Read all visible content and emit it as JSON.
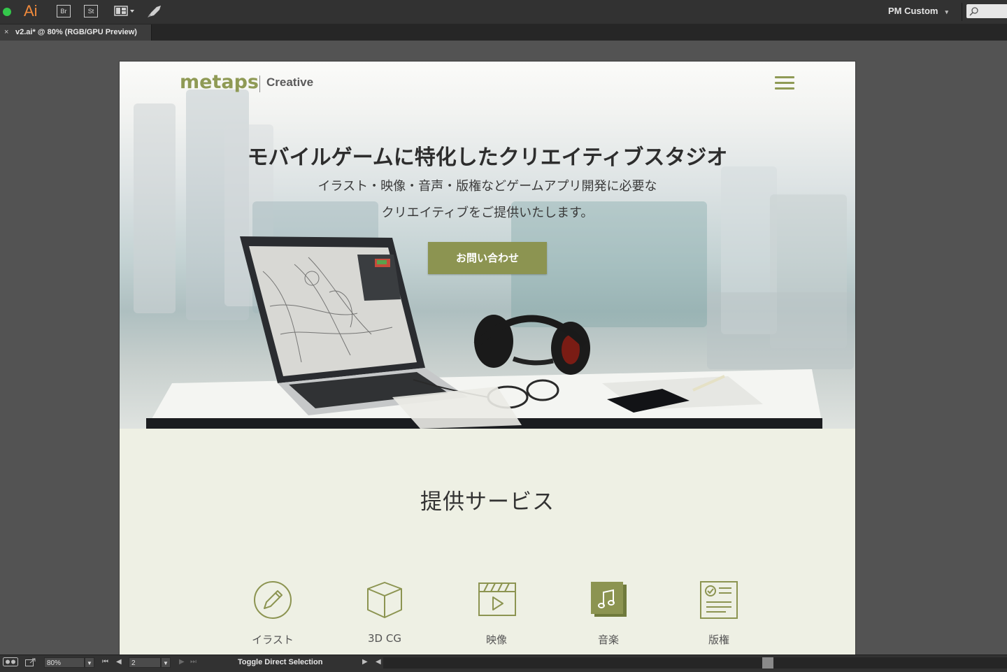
{
  "app": {
    "logo": "Ai",
    "bridge_label": "Br",
    "stock_label": "St",
    "workspace": "PM Custom",
    "colors": {
      "bar": "#323232",
      "logo": "#f08a3c",
      "status_dot": "#34c74b"
    }
  },
  "document_tab": {
    "close_glyph": "×",
    "title": "v2.ai* @ 80% (RGB/GPU Preview)"
  },
  "artboard": {
    "brand_name": "metaps",
    "brand_sub": "Creative",
    "headline": "モバイルゲームに特化したクリエイティブスタジオ",
    "subline1": "イラスト・映像・音声・版権などゲームアプリ開発に必要な",
    "subline2": "クリエイティブをご提供いたします。",
    "cta": "お問い合わせ",
    "services_title": "提供サービス",
    "services": [
      {
        "label": "イラスト",
        "icon": "pencil-circle-icon"
      },
      {
        "label": "3D CG",
        "icon": "cube-icon"
      },
      {
        "label": "映像",
        "icon": "clapperboard-play-icon"
      },
      {
        "label": "音楽",
        "icon": "music-note-icon"
      },
      {
        "label": "版権",
        "icon": "certificate-document-icon"
      }
    ],
    "colors": {
      "accent": "#8c9451",
      "background": "#eef0e4"
    }
  },
  "statusbar": {
    "zoom": "80%",
    "artboard_number": "2",
    "tool_status": "Toggle Direct Selection"
  }
}
